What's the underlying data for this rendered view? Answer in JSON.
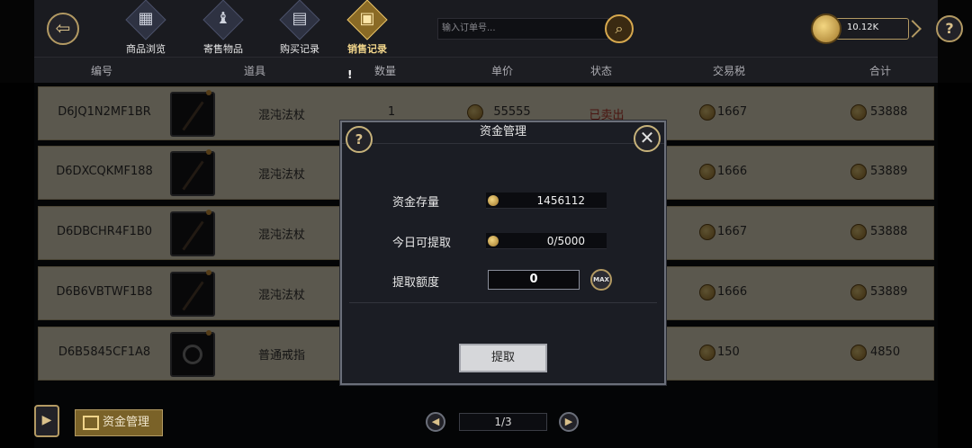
{
  "tabs": [
    {
      "label": "商品浏览",
      "icon": "shop-icon",
      "glyph": "▦",
      "active": false
    },
    {
      "label": "寄售物品",
      "icon": "bag-icon",
      "glyph": "♝",
      "active": false
    },
    {
      "label": "购买记录",
      "icon": "book-icon",
      "glyph": "▤",
      "active": false
    },
    {
      "label": "销售记录",
      "icon": "ledger-icon",
      "glyph": "▣",
      "active": true
    }
  ],
  "search": {
    "placeholder": "输入订单号..."
  },
  "currency": {
    "balance": "10.12K"
  },
  "top_help": "?",
  "cursor_mark": "!",
  "table": {
    "columns": [
      "编号",
      "道具",
      "数量",
      "单价",
      "状态",
      "交易税",
      "合计"
    ],
    "rows": [
      {
        "id": "D6JQ1N2MF1BR",
        "item": "混沌法杖",
        "qty": "1",
        "price": "55555",
        "status": "已卖出",
        "tax": "1667",
        "total": "53888",
        "kind": "staff"
      },
      {
        "id": "D6DXCQKMF188",
        "item": "混沌法杖",
        "qty": "",
        "price": "",
        "status": "",
        "tax": "1666",
        "total": "53889",
        "kind": "staff"
      },
      {
        "id": "D6DBCHR4F1B0",
        "item": "混沌法杖",
        "qty": "",
        "price": "",
        "status": "",
        "tax": "1667",
        "total": "53888",
        "kind": "staff"
      },
      {
        "id": "D6B6VBTWF1B8",
        "item": "混沌法杖",
        "qty": "",
        "price": "",
        "status": "",
        "tax": "1666",
        "total": "53889",
        "kind": "staff"
      },
      {
        "id": "D6B5845CF1A8",
        "item": "普通戒指",
        "qty": "",
        "price": "",
        "status": "",
        "tax": "150",
        "total": "4850",
        "kind": "ring"
      }
    ]
  },
  "modal": {
    "title": "资金管理",
    "help": "?",
    "close": "✕",
    "stock_label": "资金存量",
    "stock_value": "1456112",
    "today_label": "今日可提取",
    "today_value": "0/5000",
    "amount_label": "提取额度",
    "amount_value": "0",
    "max_label": "MAX",
    "submit_label": "提取"
  },
  "bottom": {
    "fund_button": "资金管理",
    "page": "1/3"
  },
  "colors": {
    "accent": "#b39a63",
    "status_sold": "#c0392b",
    "row_bg": "#f0e6cd"
  }
}
